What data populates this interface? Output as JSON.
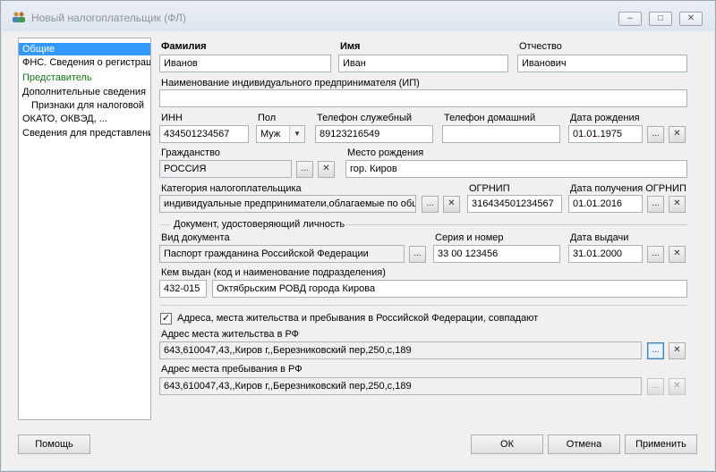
{
  "window": {
    "title": "Новый налогоплательщик (ФЛ)",
    "minimize": "–",
    "maximize": "□",
    "close": "✕"
  },
  "nav": [
    {
      "label": "Общие",
      "selected": true
    },
    {
      "label": "ФНС. Сведения о регистрации"
    },
    {
      "label": "Представитель",
      "green": true
    },
    {
      "label": "Дополнительные сведения"
    },
    {
      "label": "Признаки для налоговой"
    },
    {
      "label": "ОКАТО, ОКВЭД, ..."
    },
    {
      "label": "Сведения для представления"
    }
  ],
  "form": {
    "surname_label": "Фамилия",
    "surname": "Иванов",
    "name_label": "Имя",
    "name": "Иван",
    "patronymic_label": "Отчество",
    "patronymic": "Иванович",
    "ip_label": "Наименование индивидуального предпринимателя (ИП)",
    "ip_value": "",
    "inn_label": "ИНН",
    "inn": "434501234567",
    "gender_label": "Пол",
    "gender": "Муж",
    "work_phone_label": "Телефон служебный",
    "work_phone": "89123216549",
    "home_phone_label": "Телефон домашний",
    "home_phone": "",
    "birth_date_label": "Дата рождения",
    "birth_date": "01.01.1975",
    "citizenship_label": "Гражданство",
    "citizenship": "РОССИЯ",
    "birth_place_label": "Место рождения",
    "birth_place": "гор. Киров",
    "category_label": "Категория налогоплательщика",
    "category": "индивидуальные предприниматели,облагаемые по общ",
    "ogrnip_label": "ОГРНИП",
    "ogrnip": "316434501234567",
    "ogrnip_date_label": "Дата получения ОГРНИП",
    "ogrnip_date": "01.01.2016",
    "doc_group": "Документ, удостоверяющий личность",
    "doc_type_label": "Вид документа",
    "doc_type": "Паспорт гражданина Российской Федерации",
    "doc_series_label": "Серия и номер",
    "doc_series": "33 00 123456",
    "issue_date_label": "Дата выдачи",
    "issue_date": "31.01.2000",
    "issued_by_label": "Кем выдан (код и наименование подразделения)",
    "issued_by_code": "432-015",
    "issued_by": "Октябрьским РОВД города Кирова",
    "same_address_label": "Адреса, места жительства и пребывания в Российской Федерации, совпадают",
    "same_address_checked": "✓",
    "residence_label": "Адрес места жительства в РФ",
    "residence": "643,610047,43,,Киров г,,Березниковский пер,250,с,189",
    "stay_label": "Адрес места пребывания в РФ",
    "stay": "643,610047,43,,Киров г,,Березниковский пер,250,с,189"
  },
  "buttons": {
    "ellipsis": "...",
    "clear": "✕",
    "help": "Помощь",
    "ok": "ОК",
    "cancel": "Отмена",
    "apply": "Применить"
  },
  "icons": {
    "combo_arrow": "▼",
    "app_icon": "users-icon"
  }
}
